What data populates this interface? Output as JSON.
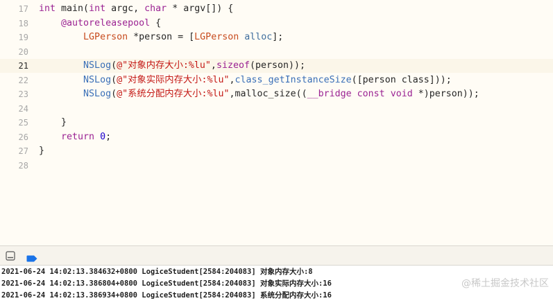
{
  "editor": {
    "lines": [
      {
        "num": "17",
        "tokens": [
          {
            "t": "int",
            "c": "kw"
          },
          {
            "t": " main(",
            "c": "plain"
          },
          {
            "t": "int",
            "c": "kw"
          },
          {
            "t": " argc, ",
            "c": "plain"
          },
          {
            "t": "char",
            "c": "kw"
          },
          {
            "t": " * argv[]) {",
            "c": "plain"
          }
        ]
      },
      {
        "num": "18",
        "tokens": [
          {
            "t": "    ",
            "c": "plain"
          },
          {
            "t": "@autoreleasepool",
            "c": "kw"
          },
          {
            "t": " {",
            "c": "plain"
          }
        ]
      },
      {
        "num": "19",
        "tokens": [
          {
            "t": "        ",
            "c": "plain"
          },
          {
            "t": "LGPerson",
            "c": "cls"
          },
          {
            "t": " *person = [",
            "c": "plain"
          },
          {
            "t": "LGPerson",
            "c": "cls"
          },
          {
            "t": " ",
            "c": "plain"
          },
          {
            "t": "alloc",
            "c": "method"
          },
          {
            "t": "];",
            "c": "plain"
          }
        ]
      },
      {
        "num": "20",
        "tokens": []
      },
      {
        "num": "21",
        "current": true,
        "tokens": [
          {
            "t": "        ",
            "c": "plain"
          },
          {
            "t": "NSLog",
            "c": "type"
          },
          {
            "t": "(",
            "c": "plain"
          },
          {
            "t": "@\"对象内存大小:%lu\"",
            "c": "str"
          },
          {
            "t": ",",
            "c": "plain"
          },
          {
            "t": "sizeof",
            "c": "kw"
          },
          {
            "t": "(person));",
            "c": "plain"
          }
        ]
      },
      {
        "num": "22",
        "tokens": [
          {
            "t": "        ",
            "c": "plain"
          },
          {
            "t": "NSLog",
            "c": "type"
          },
          {
            "t": "(",
            "c": "plain"
          },
          {
            "t": "@\"对象实际内存大小:%lu\"",
            "c": "str"
          },
          {
            "t": ",",
            "c": "plain"
          },
          {
            "t": "class_getInstanceSize",
            "c": "type"
          },
          {
            "t": "([person class]));",
            "c": "plain"
          }
        ]
      },
      {
        "num": "23",
        "tokens": [
          {
            "t": "        ",
            "c": "plain"
          },
          {
            "t": "NSLog",
            "c": "type"
          },
          {
            "t": "(",
            "c": "plain"
          },
          {
            "t": "@\"系统分配内存大小:%lu\"",
            "c": "str"
          },
          {
            "t": ",malloc_size((",
            "c": "plain"
          },
          {
            "t": "__bridge",
            "c": "kw"
          },
          {
            "t": " ",
            "c": "plain"
          },
          {
            "t": "const",
            "c": "kw"
          },
          {
            "t": " ",
            "c": "plain"
          },
          {
            "t": "void",
            "c": "kw"
          },
          {
            "t": " *)person));",
            "c": "plain"
          }
        ]
      },
      {
        "num": "24",
        "tokens": []
      },
      {
        "num": "25",
        "tokens": [
          {
            "t": "    }",
            "c": "plain"
          }
        ]
      },
      {
        "num": "26",
        "tokens": [
          {
            "t": "    ",
            "c": "plain"
          },
          {
            "t": "return",
            "c": "kw"
          },
          {
            "t": " ",
            "c": "plain"
          },
          {
            "t": "0",
            "c": "num"
          },
          {
            "t": ";",
            "c": "plain"
          }
        ]
      },
      {
        "num": "27",
        "tokens": [
          {
            "t": "}",
            "c": "plain"
          }
        ]
      },
      {
        "num": "28",
        "tokens": []
      }
    ]
  },
  "debug_bar": {
    "hide_icon": "hide-debug-area-icon",
    "breakpoint_icon": "breakpoint-icon",
    "accent": "#1a73e8"
  },
  "console": {
    "lines": [
      "2021-06-24 14:02:13.384632+0800 LogiceStudent[2584:204083] 对象内存大小:8",
      "2021-06-24 14:02:13.386804+0800 LogiceStudent[2584:204083] 对象实际内存大小:16",
      "2021-06-24 14:02:13.386934+0800 LogiceStudent[2584:204083] 系统分配内存大小:16"
    ]
  },
  "watermark": "@稀土掘金技术社区"
}
